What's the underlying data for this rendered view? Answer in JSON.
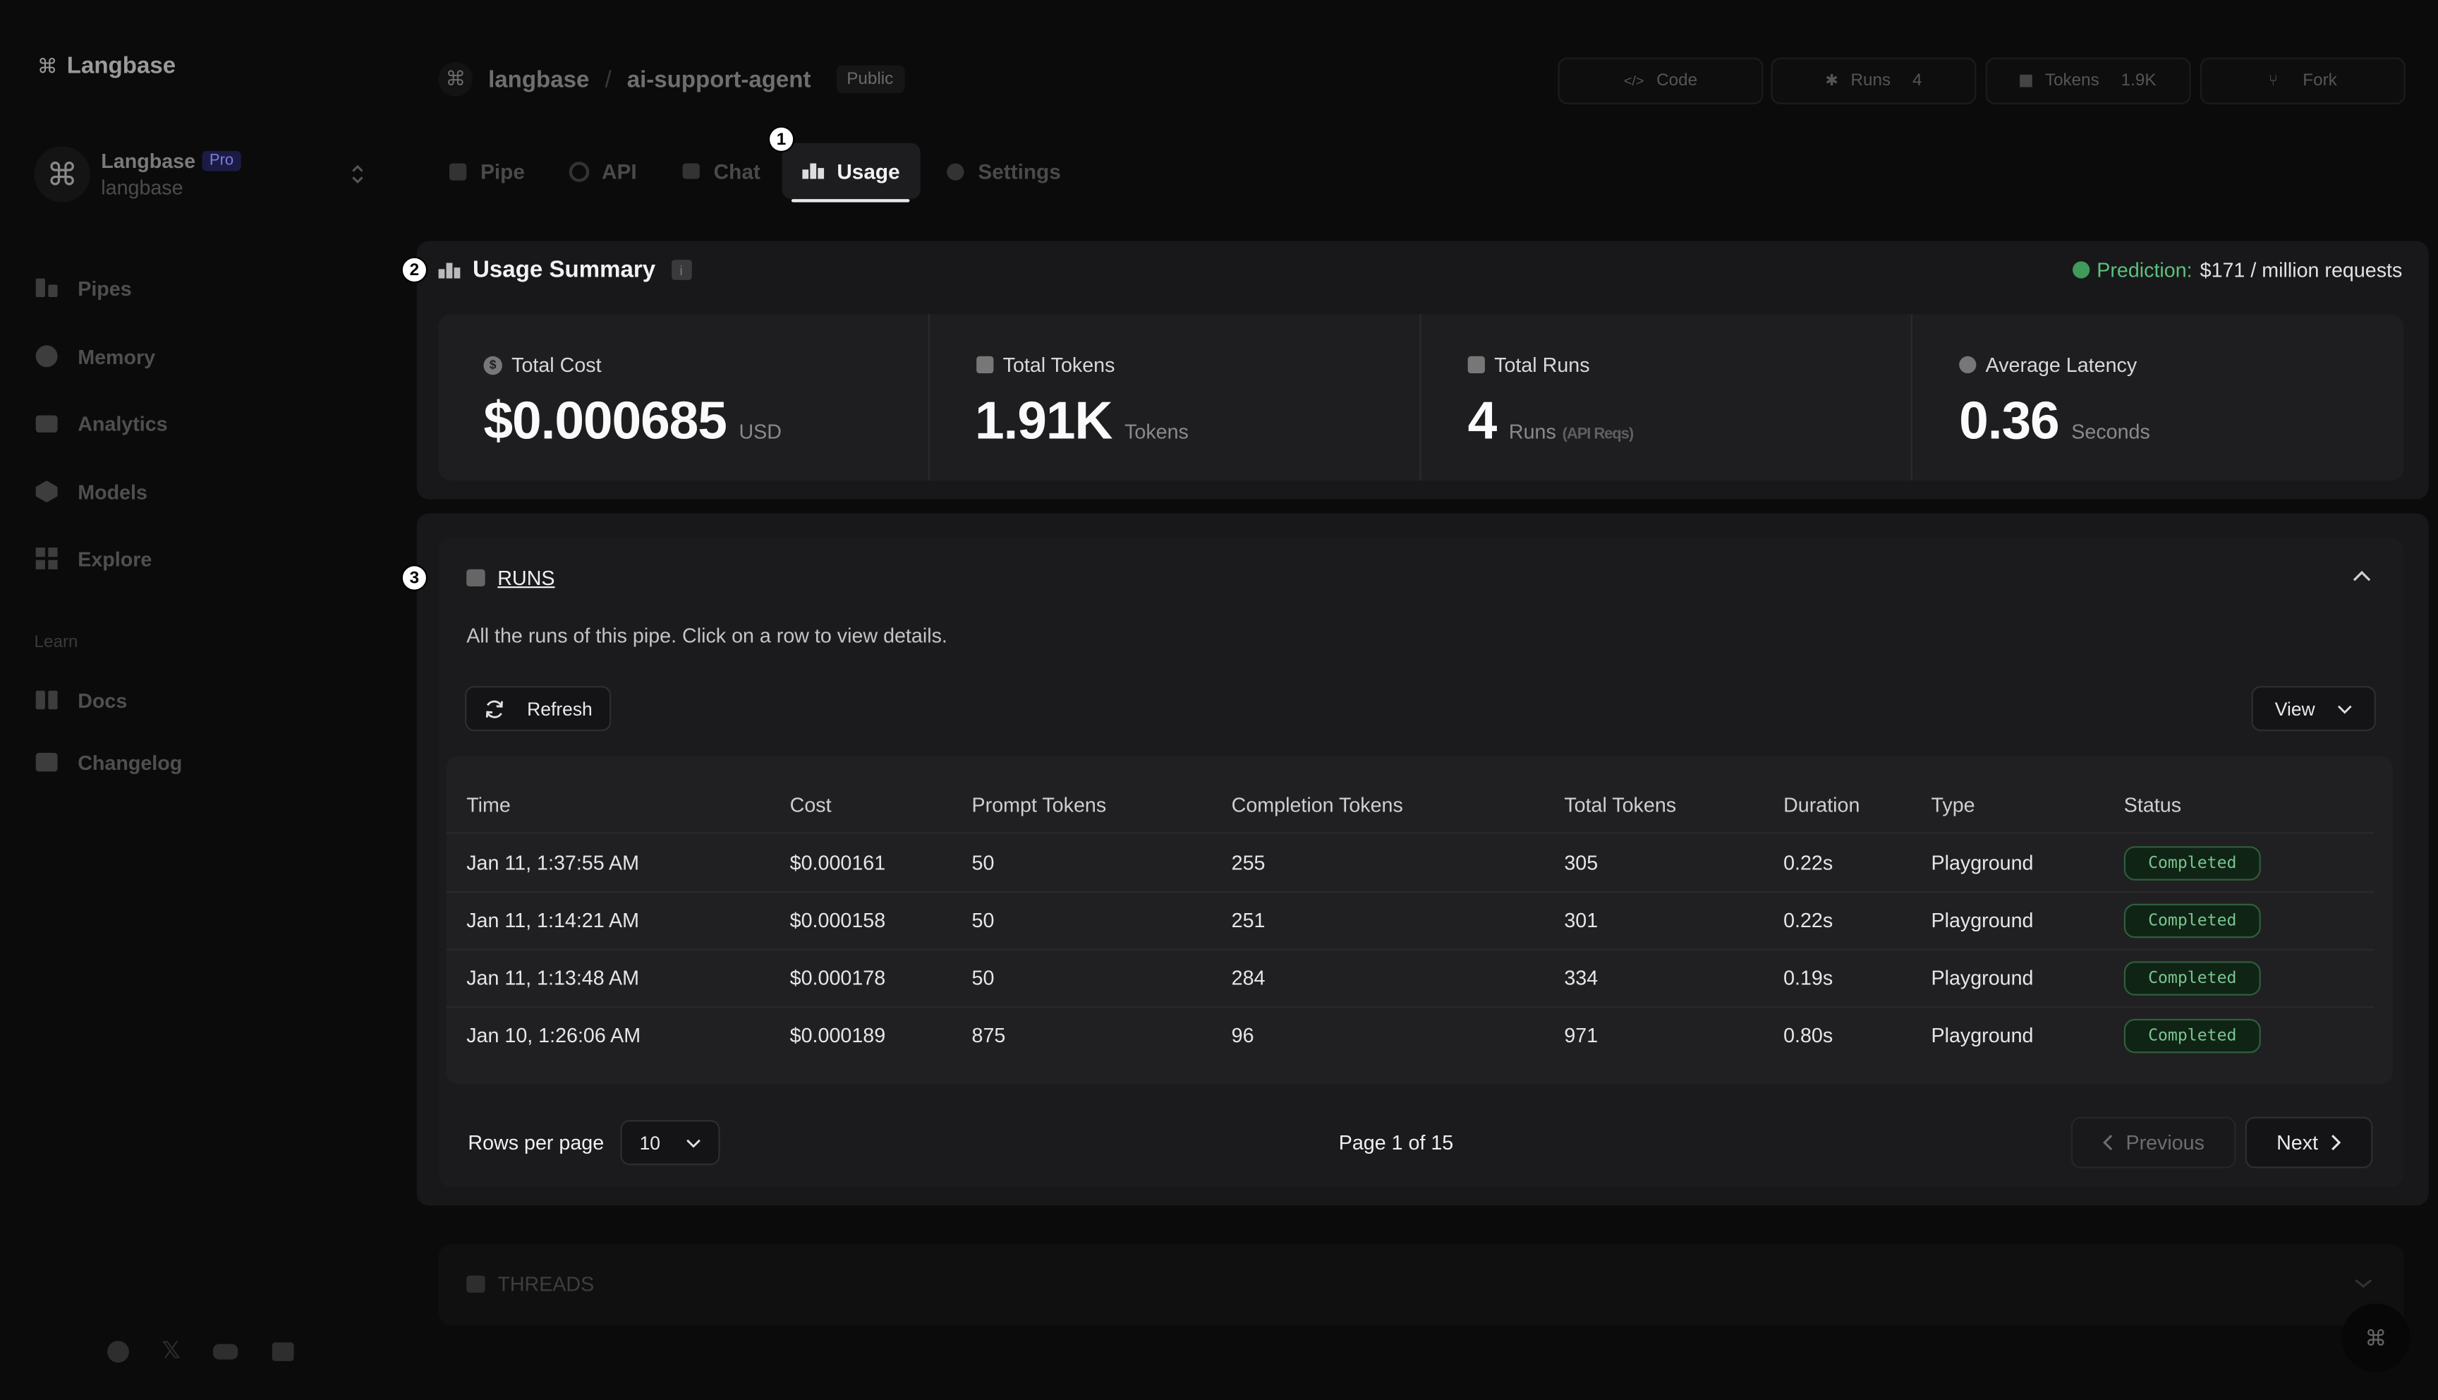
{
  "brand": {
    "name": "Langbase"
  },
  "org": {
    "name": "Langbase",
    "plan": "Pro",
    "handle": "langbase"
  },
  "sidebar": {
    "items": [
      {
        "label": "Pipes",
        "icon": "pipe-icon"
      },
      {
        "label": "Memory",
        "icon": "memory-icon"
      },
      {
        "label": "Analytics",
        "icon": "analytics-icon"
      },
      {
        "label": "Models",
        "icon": "cube-icon"
      },
      {
        "label": "Explore",
        "icon": "explore-icon"
      }
    ],
    "section_label": "Learn",
    "learn_items": [
      {
        "label": "Docs",
        "icon": "book-icon"
      },
      {
        "label": "Changelog",
        "icon": "newspaper-icon"
      }
    ]
  },
  "header": {
    "owner": "langbase",
    "separator": "/",
    "pipe_name": "ai-support-agent",
    "visibility": "Public",
    "actions": {
      "code": "Code",
      "runs": "Runs",
      "runs_count": "4",
      "tokens": "Tokens",
      "tokens_count": "1.9K",
      "fork": "Fork"
    }
  },
  "tabs": [
    {
      "label": "Pipe"
    },
    {
      "label": "API"
    },
    {
      "label": "Chat"
    },
    {
      "label": "Usage"
    },
    {
      "label": "Settings"
    }
  ],
  "markers": {
    "one": "1",
    "two": "2",
    "three": "3"
  },
  "usage_summary": {
    "title": "Usage Summary",
    "prediction_label": "Prediction:",
    "prediction_value": "$171 / million requests",
    "stats": [
      {
        "label": "Total Cost",
        "value": "$0.000685",
        "unit": "USD",
        "sub": ""
      },
      {
        "label": "Total Tokens",
        "value": "1.91K",
        "unit": "Tokens",
        "sub": ""
      },
      {
        "label": "Total Runs",
        "value": "4",
        "unit": "Runs",
        "sub": "(API Reqs)"
      },
      {
        "label": "Average Latency",
        "value": "0.36",
        "unit": "Seconds",
        "sub": ""
      }
    ]
  },
  "runs": {
    "title": "RUNS",
    "description": "All the runs of this pipe. Click on a row to view details.",
    "refresh_label": "Refresh",
    "view_label": "View",
    "columns": [
      "Time",
      "Cost",
      "Prompt Tokens",
      "Completion Tokens",
      "Total Tokens",
      "Duration",
      "Type",
      "Status"
    ],
    "rows": [
      [
        "Jan 11, 1:37:55 AM",
        "$0.000161",
        "50",
        "255",
        "305",
        "0.22s",
        "Playground",
        "Completed"
      ],
      [
        "Jan 11, 1:14:21 AM",
        "$0.000158",
        "50",
        "251",
        "301",
        "0.22s",
        "Playground",
        "Completed"
      ],
      [
        "Jan 11, 1:13:48 AM",
        "$0.000178",
        "50",
        "284",
        "334",
        "0.19s",
        "Playground",
        "Completed"
      ],
      [
        "Jan 10, 1:26:06 AM",
        "$0.000189",
        "875",
        "96",
        "971",
        "0.80s",
        "Playground",
        "Completed"
      ]
    ],
    "rows_per_page_label": "Rows per page",
    "rows_per_page_value": "10",
    "page_info": "Page 1 of 15",
    "previous_label": "Previous",
    "next_label": "Next"
  },
  "threads": {
    "title": "THREADS"
  },
  "colors": {
    "accent_green": "#4fb96f",
    "status_green": "#79c48f",
    "pro_badge": "#2b2a6e"
  }
}
